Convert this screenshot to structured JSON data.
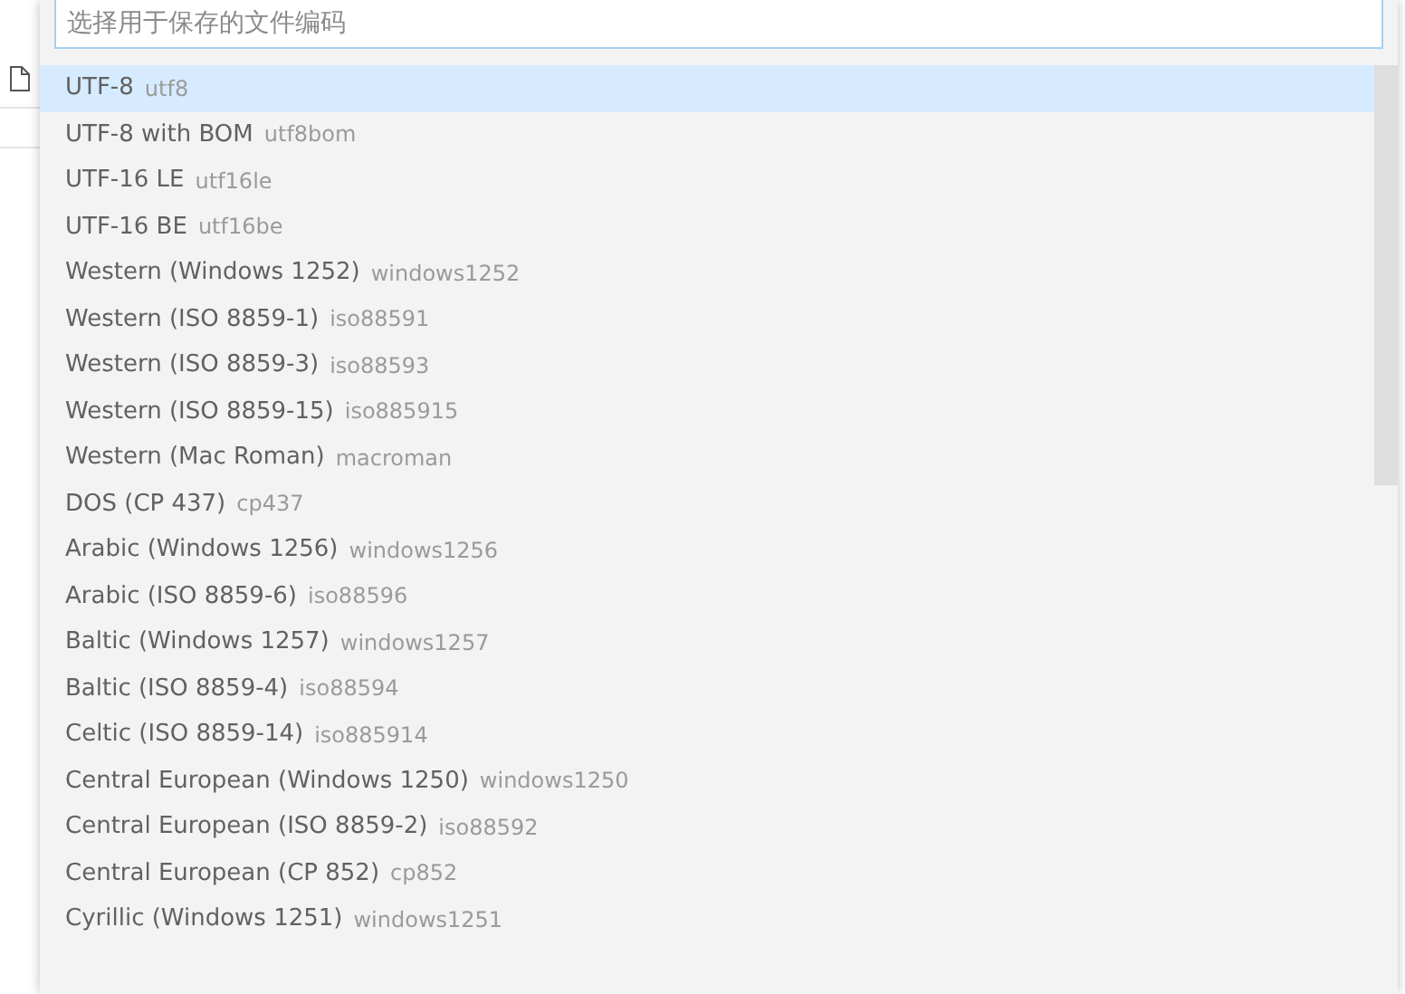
{
  "quick_pick": {
    "placeholder": "选择用于保存的文件编码",
    "items": [
      {
        "label": "UTF-8",
        "description": "utf8",
        "selected": true
      },
      {
        "label": "UTF-8 with BOM",
        "description": "utf8bom",
        "selected": false
      },
      {
        "label": "UTF-16 LE",
        "description": "utf16le",
        "selected": false
      },
      {
        "label": "UTF-16 BE",
        "description": "utf16be",
        "selected": false
      },
      {
        "label": "Western (Windows 1252)",
        "description": "windows1252",
        "selected": false
      },
      {
        "label": "Western (ISO 8859-1)",
        "description": "iso88591",
        "selected": false
      },
      {
        "label": "Western (ISO 8859-3)",
        "description": "iso88593",
        "selected": false
      },
      {
        "label": "Western (ISO 8859-15)",
        "description": "iso885915",
        "selected": false
      },
      {
        "label": "Western (Mac Roman)",
        "description": "macroman",
        "selected": false
      },
      {
        "label": "DOS (CP 437)",
        "description": "cp437",
        "selected": false
      },
      {
        "label": "Arabic (Windows 1256)",
        "description": "windows1256",
        "selected": false
      },
      {
        "label": "Arabic (ISO 8859-6)",
        "description": "iso88596",
        "selected": false
      },
      {
        "label": "Baltic (Windows 1257)",
        "description": "windows1257",
        "selected": false
      },
      {
        "label": "Baltic (ISO 8859-4)",
        "description": "iso88594",
        "selected": false
      },
      {
        "label": "Celtic (ISO 8859-14)",
        "description": "iso885914",
        "selected": false
      },
      {
        "label": "Central European (Windows 1250)",
        "description": "windows1250",
        "selected": false
      },
      {
        "label": "Central European (ISO 8859-2)",
        "description": "iso88592",
        "selected": false
      },
      {
        "label": "Central European (CP 852)",
        "description": "cp852",
        "selected": false
      },
      {
        "label": "Cyrillic (Windows 1251)",
        "description": "windows1251",
        "selected": false
      }
    ]
  }
}
